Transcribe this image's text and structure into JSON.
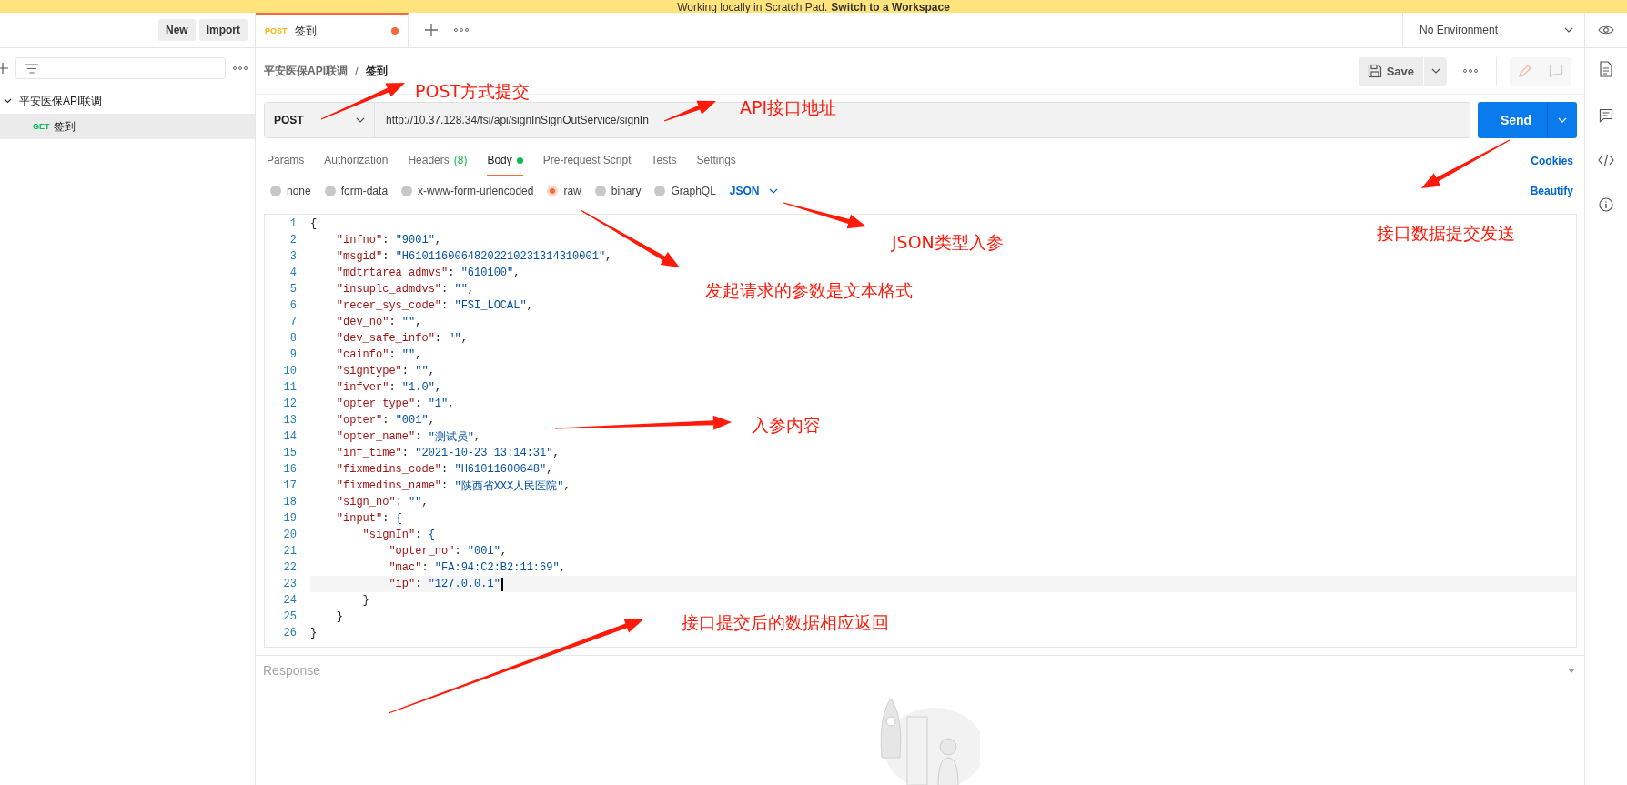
{
  "banner": {
    "text": "Working locally in Scratch Pad.",
    "link": "Switch to a Workspace"
  },
  "sidebar": {
    "buttons": [
      "New",
      "Import"
    ],
    "tree": [
      {
        "label": "平安医保API联调",
        "expanded": true,
        "selected": false,
        "children": [
          {
            "method": "GET",
            "label": "签到",
            "selected": true
          }
        ]
      }
    ]
  },
  "tab": {
    "method": "POST",
    "title": "签到",
    "unsaved": true
  },
  "environment": {
    "value": "No Environment"
  },
  "breadcrumb": {
    "parent": "平安医保API联调",
    "separator": "/",
    "current": "签到"
  },
  "toolbar": {
    "save": "Save"
  },
  "request": {
    "method": "POST",
    "url": "http://10.37.128.34/fsi/api/signInSignOutService/signIn",
    "send": "Send"
  },
  "request_tabs": [
    {
      "label": "Params",
      "selected": false
    },
    {
      "label": "Authorization",
      "selected": false
    },
    {
      "label": "Headers",
      "count": "(8)",
      "selected": false
    },
    {
      "label": "Body",
      "dot": true,
      "selected": true
    },
    {
      "label": "Pre-request Script",
      "selected": false
    },
    {
      "label": "Tests",
      "selected": false
    },
    {
      "label": "Settings",
      "selected": false
    }
  ],
  "cookies": "Cookies",
  "body_types": [
    {
      "label": "none",
      "selected": false
    },
    {
      "label": "form-data",
      "selected": false
    },
    {
      "label": "x-www-form-urlencoded",
      "selected": false
    },
    {
      "label": "raw",
      "selected": true
    },
    {
      "label": "binary",
      "selected": false
    },
    {
      "label": "GraphQL",
      "selected": false
    }
  ],
  "format": "JSON",
  "beautify": "Beautify",
  "code": [
    {
      "number": "1",
      "text": "{",
      "active": false
    },
    {
      "number": "2",
      "text": "    \"infno\": \"9001\",",
      "active": false
    },
    {
      "number": "3",
      "text": "    \"msgid\": \"H61011600648202210231314310001\",",
      "active": false
    },
    {
      "number": "4",
      "text": "    \"mdtrtarea_admvs\": \"610100\",",
      "active": false
    },
    {
      "number": "5",
      "text": "    \"insuplc_admdvs\": \"\",",
      "active": false
    },
    {
      "number": "6",
      "text": "    \"recer_sys_code\": \"FSI_LOCAL\",",
      "active": false
    },
    {
      "number": "7",
      "text": "    \"dev_no\": \"\",",
      "active": false
    },
    {
      "number": "8",
      "text": "    \"dev_safe_info\": \"\",",
      "active": false
    },
    {
      "number": "9",
      "text": "    \"cainfo\": \"\",",
      "active": false
    },
    {
      "number": "10",
      "text": "    \"signtype\": \"\",",
      "active": false
    },
    {
      "number": "11",
      "text": "    \"infver\": \"1.0\",",
      "active": false
    },
    {
      "number": "12",
      "text": "    \"opter_type\": \"1\",",
      "active": false
    },
    {
      "number": "13",
      "text": "    \"opter\": \"001\",",
      "active": false
    },
    {
      "number": "14",
      "text": "    \"opter_name\": \"测试员\",",
      "active": false
    },
    {
      "number": "15",
      "text": "    \"inf_time\": \"2021-10-23 13:14:31\",",
      "active": false
    },
    {
      "number": "16",
      "text": "    \"fixmedins_code\": \"H61011600648\",",
      "active": false
    },
    {
      "number": "17",
      "text": "    \"fixmedins_name\": \"陕西省XXX人民医院\",",
      "active": false
    },
    {
      "number": "18",
      "text": "    \"sign_no\": \"\",",
      "active": false
    },
    {
      "number": "19",
      "text": "    \"input\": {",
      "active": false
    },
    {
      "number": "20",
      "text": "        \"signIn\": {",
      "active": false
    },
    {
      "number": "21",
      "text": "            \"opter_no\": \"001\",",
      "active": false
    },
    {
      "number": "22",
      "text": "            \"mac\": \"FA:94:C2:B2:11:69\",",
      "active": false
    },
    {
      "number": "23",
      "text": "            \"ip\": \"127.0.0.1\"",
      "active": true
    },
    {
      "number": "24",
      "text": "        }",
      "active": false
    },
    {
      "number": "25",
      "text": "    }",
      "active": false
    },
    {
      "number": "26",
      "text": "}",
      "active": false
    }
  ],
  "response": {
    "label": "Response"
  },
  "annotations": [
    "POST方式提交",
    "API接口地址",
    "接口数据提交发送",
    "JSON类型入参",
    "发起请求的参数是文本格式",
    "入参内容",
    "接口提交后的数据相应返回"
  ]
}
